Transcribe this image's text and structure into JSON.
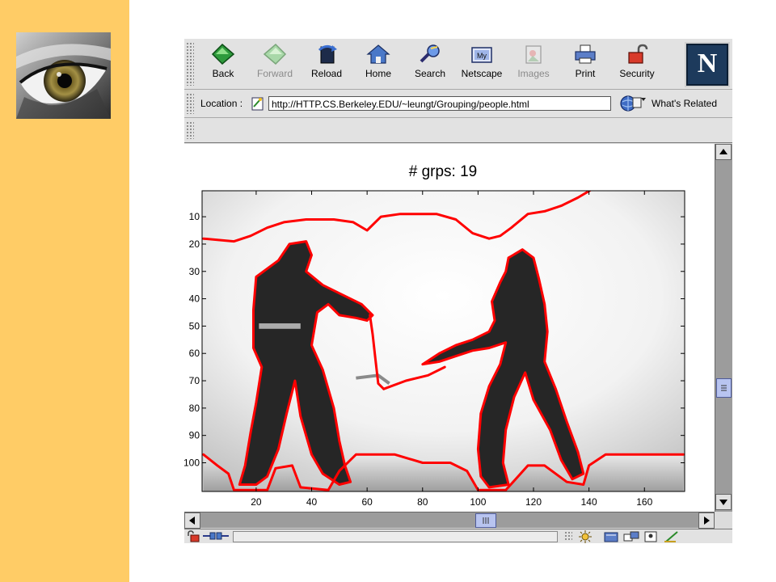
{
  "browser": {
    "toolbar": [
      {
        "label": "Back",
        "icon": "back-arrow-icon",
        "enabled": true
      },
      {
        "label": "Forward",
        "icon": "forward-arrow-icon",
        "enabled": false
      },
      {
        "label": "Reload",
        "icon": "reload-icon",
        "enabled": true
      },
      {
        "label": "Home",
        "icon": "home-icon",
        "enabled": true
      },
      {
        "label": "Search",
        "icon": "search-icon",
        "enabled": true
      },
      {
        "label": "Netscape",
        "icon": "my-netscape-icon",
        "enabled": true
      },
      {
        "label": "Images",
        "icon": "images-icon",
        "enabled": false
      },
      {
        "label": "Print",
        "icon": "print-icon",
        "enabled": true
      },
      {
        "label": "Security",
        "icon": "security-lock-icon",
        "enabled": true
      }
    ],
    "logo_letter": "N",
    "location_label": "Location :",
    "url": "http://HTTP.CS.Berkeley.EDU/~leungt/Grouping/people.html",
    "whats_related": "What's Related",
    "colors": {
      "sidebar": "#ffcc66",
      "chrome": "#e2e2e2",
      "scroll_thumb": "#b8c4f0",
      "contour": "#ff0000"
    }
  },
  "chart_data": {
    "type": "image-plot",
    "title": "# grps: 19",
    "xlabel": "",
    "ylabel": "",
    "xlim": [
      0.5,
      174.5
    ],
    "ylim": [
      110.5,
      0.5
    ],
    "xticks": [
      20,
      40,
      60,
      80,
      100,
      120,
      140,
      160
    ],
    "yticks": [
      10,
      20,
      30,
      40,
      50,
      60,
      70,
      80,
      90,
      100
    ],
    "grid": false,
    "image_content": "grayscale photo of two people swinging golf clubs with red segmentation contours",
    "contours": [
      {
        "name": "background-top",
        "points": [
          [
            1,
            18
          ],
          [
            12,
            19
          ],
          [
            18,
            17
          ],
          [
            24,
            14
          ],
          [
            30,
            12
          ],
          [
            38,
            11
          ],
          [
            48,
            11
          ],
          [
            55,
            12
          ],
          [
            60,
            15
          ],
          [
            65,
            10
          ],
          [
            72,
            9
          ],
          [
            85,
            9
          ],
          [
            92,
            11
          ],
          [
            98,
            16
          ],
          [
            104,
            18
          ],
          [
            108,
            17
          ],
          [
            112,
            14
          ],
          [
            118,
            9
          ],
          [
            124,
            8
          ],
          [
            130,
            6
          ],
          [
            136,
            3
          ],
          [
            141,
            0
          ]
        ]
      },
      {
        "name": "person-left",
        "points": [
          [
            28,
            26
          ],
          [
            32,
            20
          ],
          [
            38,
            19
          ],
          [
            40,
            24
          ],
          [
            38,
            30
          ],
          [
            44,
            35
          ],
          [
            50,
            38
          ],
          [
            58,
            42
          ],
          [
            62,
            46
          ],
          [
            60,
            48
          ],
          [
            56,
            47
          ],
          [
            50,
            46
          ],
          [
            46,
            42
          ],
          [
            42,
            45
          ],
          [
            40,
            57
          ],
          [
            44,
            66
          ],
          [
            48,
            80
          ],
          [
            50,
            92
          ],
          [
            52,
            101
          ],
          [
            54,
            107
          ],
          [
            50,
            108
          ],
          [
            44,
            104
          ],
          [
            40,
            97
          ],
          [
            36,
            83
          ],
          [
            34,
            70
          ],
          [
            31,
            82
          ],
          [
            28,
            95
          ],
          [
            24,
            105
          ],
          [
            20,
            108
          ],
          [
            14,
            108
          ],
          [
            16,
            101
          ],
          [
            18,
            89
          ],
          [
            20,
            78
          ],
          [
            22,
            65
          ],
          [
            19,
            58
          ],
          [
            19,
            44
          ],
          [
            20,
            32
          ],
          [
            28,
            26
          ]
        ]
      },
      {
        "name": "club-left",
        "points": [
          [
            61,
            46
          ],
          [
            62,
            53
          ],
          [
            63,
            62
          ],
          [
            64,
            71
          ],
          [
            66,
            73
          ]
        ]
      },
      {
        "name": "person-right",
        "points": [
          [
            111,
            25
          ],
          [
            116,
            22
          ],
          [
            120,
            25
          ],
          [
            122,
            33
          ],
          [
            124,
            42
          ],
          [
            125,
            52
          ],
          [
            124,
            63
          ],
          [
            128,
            73
          ],
          [
            132,
            85
          ],
          [
            136,
            96
          ],
          [
            138,
            104
          ],
          [
            134,
            106
          ],
          [
            130,
            99
          ],
          [
            126,
            88
          ],
          [
            120,
            77
          ],
          [
            117,
            67
          ],
          [
            113,
            76
          ],
          [
            110,
            88
          ],
          [
            109,
            100
          ],
          [
            111,
            108
          ],
          [
            104,
            109
          ],
          [
            101,
            105
          ],
          [
            100,
            95
          ],
          [
            101,
            82
          ],
          [
            104,
            72
          ],
          [
            108,
            64
          ],
          [
            110,
            56
          ],
          [
            104,
            58
          ],
          [
            98,
            59
          ],
          [
            92,
            61
          ],
          [
            86,
            63
          ],
          [
            80,
            64
          ],
          [
            86,
            60
          ],
          [
            92,
            57
          ],
          [
            98,
            55
          ],
          [
            104,
            52
          ],
          [
            106,
            48
          ],
          [
            105,
            41
          ],
          [
            108,
            34
          ],
          [
            110,
            30
          ],
          [
            111,
            25
          ]
        ]
      },
      {
        "name": "club-right",
        "points": [
          [
            66,
            73
          ],
          [
            74,
            70
          ],
          [
            82,
            68
          ],
          [
            88,
            65
          ]
        ]
      },
      {
        "name": "floor",
        "points": [
          [
            1,
            97
          ],
          [
            6,
            101
          ],
          [
            10,
            104
          ],
          [
            12,
            110
          ],
          [
            24,
            110
          ],
          [
            27,
            102
          ],
          [
            33,
            101
          ],
          [
            36,
            109
          ],
          [
            46,
            110
          ],
          [
            50,
            103
          ],
          [
            56,
            97
          ],
          [
            70,
            97
          ],
          [
            80,
            100
          ],
          [
            90,
            100
          ],
          [
            96,
            103
          ],
          [
            100,
            110
          ],
          [
            110,
            110
          ],
          [
            118,
            101
          ],
          [
            124,
            101
          ],
          [
            132,
            107
          ],
          [
            138,
            108
          ],
          [
            140,
            101
          ],
          [
            146,
            97
          ],
          [
            174,
            97
          ]
        ]
      }
    ]
  }
}
